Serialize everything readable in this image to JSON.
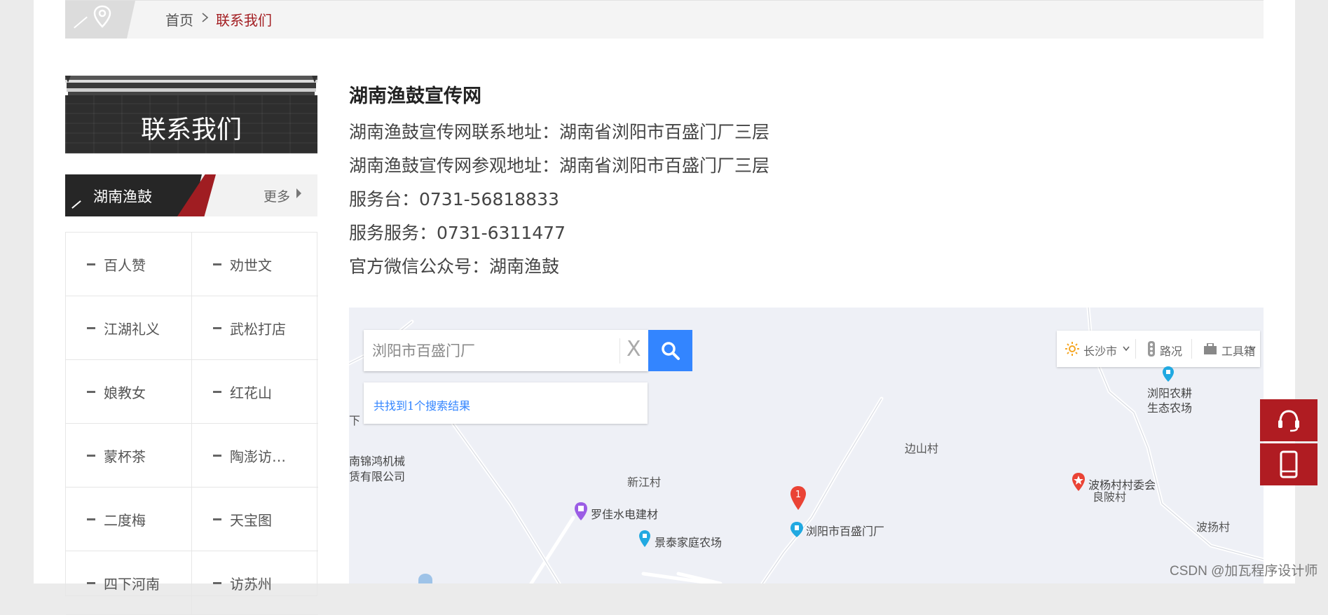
{
  "breadcrumb": {
    "home": "首页",
    "current": "联系我们"
  },
  "sidebar": {
    "title": "联系我们",
    "category_title": "湖南渔鼓",
    "more_label": "更多",
    "items": [
      {
        "label": "百人赞"
      },
      {
        "label": "劝世文"
      },
      {
        "label": "江湖礼义"
      },
      {
        "label": "武松打店"
      },
      {
        "label": "娘教女"
      },
      {
        "label": "红花山"
      },
      {
        "label": "蒙杯茶"
      },
      {
        "label": "陶澎访…"
      },
      {
        "label": "二度梅"
      },
      {
        "label": "天宝图"
      },
      {
        "label": "四下河南"
      },
      {
        "label": "访苏州"
      }
    ]
  },
  "contact": {
    "title": "湖南渔鼓宣传网",
    "lines": [
      "湖南渔鼓宣传网联系地址：湖南省浏阳市百盛门厂三层",
      "湖南渔鼓宣传网参观地址：湖南省浏阳市百盛门厂三层",
      "服务台：0731-56818833",
      "服务服务：0731-6311477",
      "官方微信公众号：湖南渔鼓"
    ]
  },
  "map": {
    "search_value": "浏阳市百盛门厂",
    "clear_label": "X",
    "result_text": "共找到1个搜索结果",
    "tools": {
      "city": "长沙市",
      "traffic": "路况",
      "toolbox": "工具箱"
    },
    "pois": [
      {
        "label": "浏阳农耕\n生态农场"
      },
      {
        "label": "罗佳水电建材"
      },
      {
        "label": "景泰家庭农场"
      },
      {
        "label": "浏阳市百盛门厂"
      },
      {
        "label": "波杨村村委会"
      }
    ],
    "villages": {
      "v1": "边山村",
      "v2": "新江村",
      "v3": "良陂村",
      "v4": "波扬村",
      "v5": "下",
      "v6a": "南锦鸿机械",
      "v6b": "赁有限公司"
    },
    "marker_number": "1"
  },
  "watermark": "CSDN @加瓦程序设计师",
  "colors": {
    "accent_red": "#a31e22",
    "map_blue": "#3385ff"
  }
}
